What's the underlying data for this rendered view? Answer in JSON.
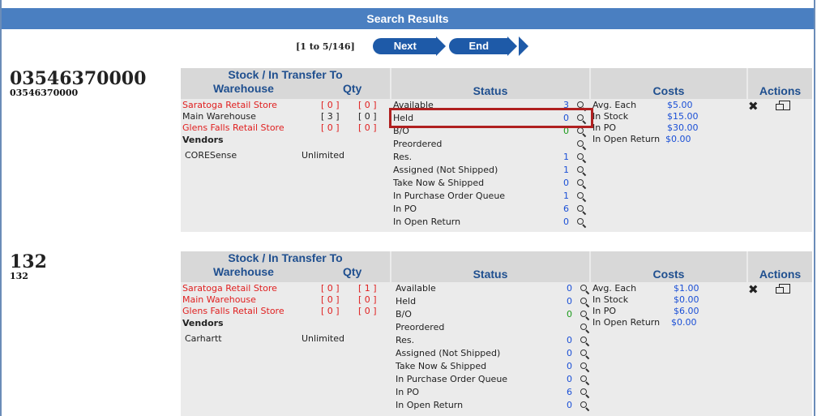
{
  "header": {
    "title": "Search Results"
  },
  "pager": {
    "range": "[1 to 5/146]",
    "next": "Next",
    "end": "End"
  },
  "columns": {
    "stock_title": "Stock / In Transfer To",
    "warehouse": "Warehouse",
    "qty": "Qty",
    "status": "Status",
    "costs": "Costs",
    "actions": "Actions",
    "vendors": "Vendors"
  },
  "items": [
    {
      "code": "03546370000",
      "sub_code": "03546370000",
      "warehouses": [
        {
          "name": "Saratoga Retail Store",
          "qty": "[ 0 ]",
          "transfer": "[ 0 ]",
          "color": "#e02020"
        },
        {
          "name": "Main Warehouse",
          "qty": "[ 3 ]",
          "transfer": "[ 0 ]",
          "color": "#222222"
        },
        {
          "name": "Glens Falls Retail Store",
          "qty": "[ 0 ]",
          "transfer": "[ 0 ]",
          "color": "#e02020"
        }
      ],
      "vendor": {
        "name": "CORESense",
        "qty": "Unlimited"
      },
      "status": [
        {
          "label": "Available",
          "value": "3"
        },
        {
          "label": "Held",
          "value": "0"
        },
        {
          "label": "B/O",
          "value": "0"
        },
        {
          "label": "Preordered",
          "value": ""
        },
        {
          "label": "Res.",
          "value": "1"
        },
        {
          "label": "Assigned (Not Shipped)",
          "value": "1"
        },
        {
          "label": "Take Now & Shipped",
          "value": "0"
        },
        {
          "label": "In Purchase Order Queue",
          "value": "1"
        },
        {
          "label": "In PO",
          "value": "6"
        },
        {
          "label": "In Open Return",
          "value": "0"
        }
      ],
      "costs": [
        {
          "label": "Avg. Each",
          "value": "$5.00"
        },
        {
          "label": "In Stock",
          "value": "$15.00"
        },
        {
          "label": "In PO",
          "value": "$30.00"
        },
        {
          "label": "In Open Return",
          "value": "$0.00"
        }
      ]
    },
    {
      "code": "132",
      "sub_code": "132",
      "warehouses": [
        {
          "name": "Saratoga Retail Store",
          "qty": "[ 0 ]",
          "transfer": "[ 1 ]",
          "color": "#e02020"
        },
        {
          "name": "Main Warehouse",
          "qty": "[ 0 ]",
          "transfer": "[ 0 ]",
          "color": "#e02020"
        },
        {
          "name": "Glens Falls Retail Store",
          "qty": "[ 0 ]",
          "transfer": "[ 0 ]",
          "color": "#e02020"
        }
      ],
      "vendor": {
        "name": "Carhartt",
        "qty": "Unlimited"
      },
      "status": [
        {
          "label": "Available",
          "value": "0"
        },
        {
          "label": "Held",
          "value": "0"
        },
        {
          "label": "B/O",
          "value": "0"
        },
        {
          "label": "Preordered",
          "value": ""
        },
        {
          "label": "Res.",
          "value": "0"
        },
        {
          "label": "Assigned (Not Shipped)",
          "value": "0"
        },
        {
          "label": "Take Now & Shipped",
          "value": "0"
        },
        {
          "label": "In Purchase Order Queue",
          "value": "0"
        },
        {
          "label": "In PO",
          "value": "6"
        },
        {
          "label": "In Open Return",
          "value": "0"
        }
      ],
      "costs": [
        {
          "label": "Avg. Each",
          "value": "$1.00"
        },
        {
          "label": "In Stock",
          "value": "$0.00"
        },
        {
          "label": "In PO",
          "value": "$6.00"
        },
        {
          "label": "In Open Return",
          "value": "$0.00"
        }
      ]
    }
  ]
}
